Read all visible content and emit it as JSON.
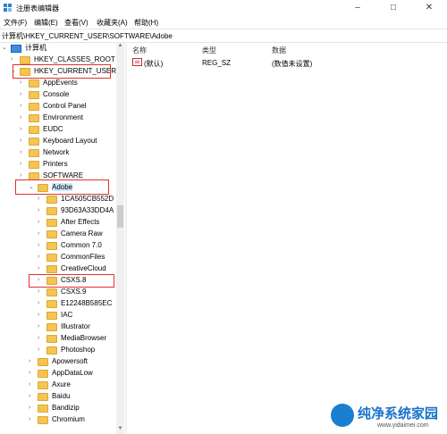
{
  "window": {
    "title": "注册表编辑器",
    "minimize": "–",
    "maximize": "□",
    "close": "✕"
  },
  "menu": [
    "文件(F)",
    "编辑(E)",
    "查看(V)",
    "收藏夹(A)",
    "帮助(H)"
  ],
  "address": "计算机\\HKEY_CURRENT_USER\\SOFTWARE\\Adobe",
  "tree": {
    "root": "计算机",
    "hkcr": "HKEY_CLASSES_ROOT",
    "hkcu": "HKEY_CURRENT_USER",
    "hkcu_children": [
      "AppEvents",
      "Console",
      "Control Panel",
      "Environment",
      "EUDC",
      "Keyboard Layout",
      "Network",
      "Printers",
      "SOFTWARE"
    ],
    "adobe": "Adobe",
    "adobe_children": [
      "1CA505CB552D",
      "93D63A33DD4A",
      "After Effects",
      "Camera Raw",
      "Common 7.0",
      "CommonFiles",
      "CreativeCloud",
      "CSXS.8",
      "CSXS.9",
      "E12248B585EC",
      "IAC",
      "Illustrator",
      "MediaBrowser",
      "Photoshop"
    ],
    "software_children": [
      "Apowersoft",
      "AppDataLow",
      "Axure",
      "Baidu",
      "Bandizip",
      "Chromium"
    ]
  },
  "list": {
    "headers": {
      "name": "名称",
      "type": "类型",
      "data": "数据"
    },
    "rows": [
      {
        "icon": "ab",
        "name": "(默认)",
        "type": "REG_SZ",
        "data": "(数值未设置)"
      }
    ]
  },
  "watermark": {
    "text": "纯净系统家园",
    "url": "www.yidaimei.com"
  }
}
